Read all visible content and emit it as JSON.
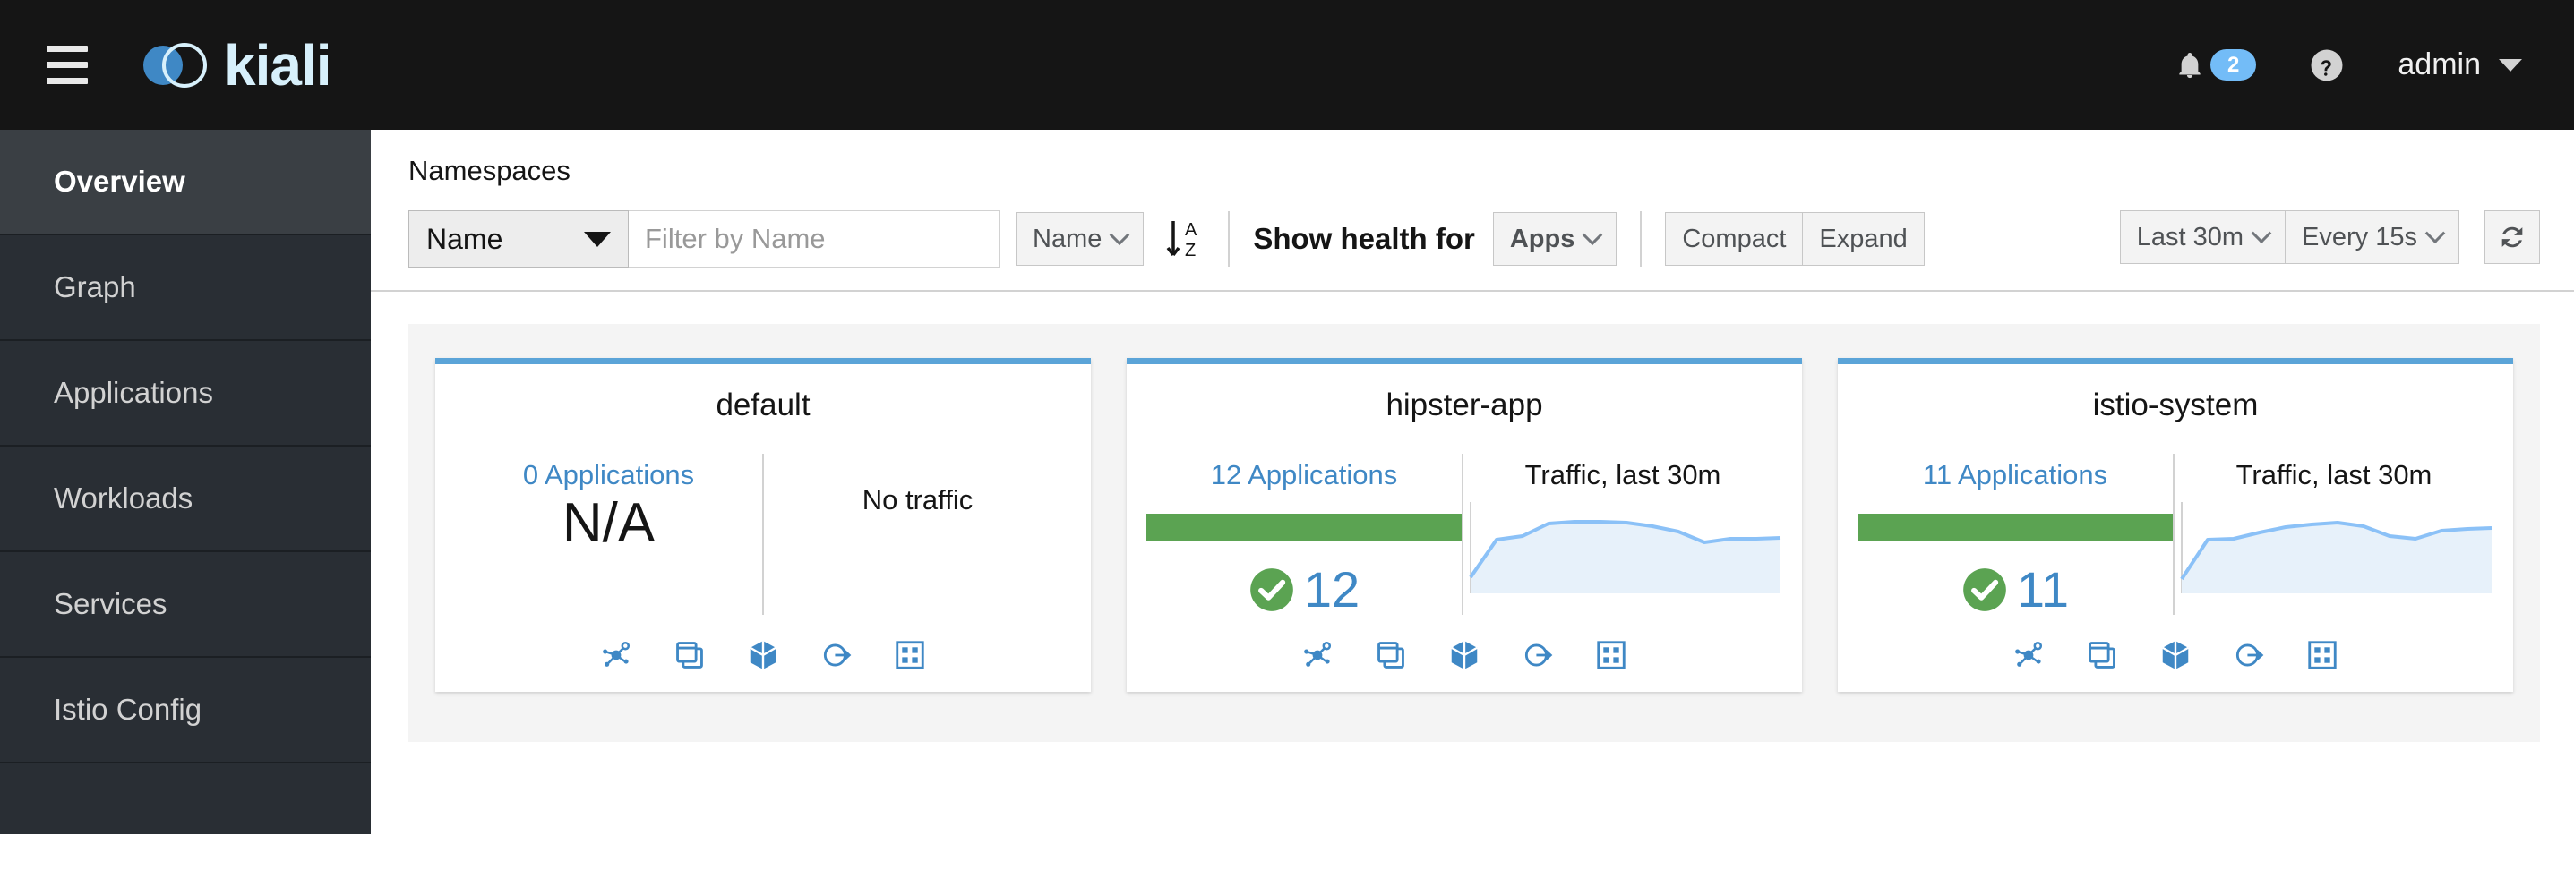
{
  "masthead": {
    "menu_icon": "hamburger-icon",
    "brand": "kiali",
    "notifications": {
      "icon": "bell-icon",
      "count": "2"
    },
    "help": {
      "icon": "question-circle-icon"
    },
    "user": {
      "name": "admin",
      "caret": "caret-down-icon"
    }
  },
  "sidebar": {
    "items": [
      {
        "label": "Overview",
        "active": true
      },
      {
        "label": "Graph",
        "active": false
      },
      {
        "label": "Applications",
        "active": false
      },
      {
        "label": "Workloads",
        "active": false
      },
      {
        "label": "Services",
        "active": false
      },
      {
        "label": "Istio Config",
        "active": false
      },
      {
        "label": "",
        "active": false
      }
    ]
  },
  "page": {
    "title": "Namespaces"
  },
  "toolbar": {
    "filter_select": "Name",
    "filter_placeholder": "Filter by Name",
    "filter_value": "",
    "sort_select": "Name",
    "sort_direction_icon": "sort-alpha-asc-icon",
    "show_health_label": "Show health for",
    "health_select": "Apps",
    "compact_label": "Compact",
    "expand_label": "Expand",
    "time_range": "Last 30m",
    "refresh_interval": "Every 15s",
    "refresh_icon": "refresh-icon"
  },
  "colors": {
    "accent_blue": "#3f88c5",
    "card_top_border": "#5ba4d8",
    "health_green": "#5ba352",
    "masthead_bg": "#151515",
    "sidebar_bg": "#292e34",
    "sidebar_active_bg": "#3a3f44",
    "content_panel_bg": "#f4f4f4",
    "badge_blue": "#73bcf7",
    "sparkline_stroke": "#8bc1f7",
    "sparkline_fill": "#e7f1fa"
  },
  "card_action_icons": [
    {
      "name": "graph-topology-icon",
      "label": "Graph"
    },
    {
      "name": "applications-icon",
      "label": "Applications"
    },
    {
      "name": "workloads-cube-icon",
      "label": "Workloads"
    },
    {
      "name": "services-icon",
      "label": "Services"
    },
    {
      "name": "istio-config-icon",
      "label": "Istio Config"
    }
  ],
  "namespaces": [
    {
      "name": "default",
      "apps_link": "0 Applications",
      "has_health_bar": false,
      "health_value": "N/A",
      "traffic_title": "",
      "traffic_empty_label": "No traffic",
      "has_traffic": false
    },
    {
      "name": "hipster-app",
      "apps_link": "12 Applications",
      "has_health_bar": true,
      "health_value": "12",
      "traffic_title": "Traffic, last 30m",
      "traffic_empty_label": "",
      "has_traffic": true
    },
    {
      "name": "istio-system",
      "apps_link": "11 Applications",
      "has_health_bar": true,
      "health_value": "11",
      "traffic_title": "Traffic, last 30m",
      "traffic_empty_label": "",
      "has_traffic": true
    }
  ],
  "chart_data": [
    {
      "type": "area",
      "title": "Traffic, last 30m",
      "namespace": "hipster-app",
      "xlabel": "",
      "ylabel": "",
      "grid": false,
      "legend": "none",
      "x": [
        0,
        1,
        2,
        3,
        4,
        5,
        6,
        7,
        8,
        9,
        10,
        11,
        12
      ],
      "values": [
        18,
        72,
        76,
        88,
        90,
        90,
        89,
        87,
        84,
        76,
        79,
        79,
        80
      ],
      "ylim": [
        0,
        100
      ]
    },
    {
      "type": "area",
      "title": "Traffic, last 30m",
      "namespace": "istio-system",
      "xlabel": "",
      "ylabel": "",
      "grid": false,
      "legend": "none",
      "x": [
        0,
        1,
        2,
        3,
        4,
        5,
        6,
        7,
        8,
        9,
        10,
        11,
        12
      ],
      "values": [
        16,
        72,
        73,
        80,
        86,
        88,
        90,
        86,
        78,
        75,
        83,
        84,
        85
      ],
      "ylim": [
        0,
        100
      ]
    }
  ]
}
